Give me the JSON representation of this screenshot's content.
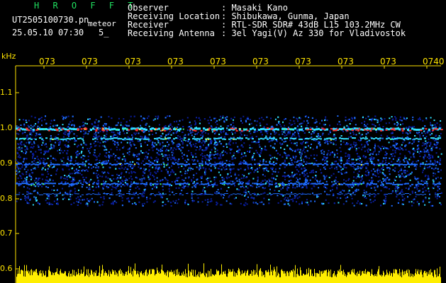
{
  "header": {
    "title": "H R O F F T",
    "filename": "UT2505100730.pn",
    "mode": "meteor",
    "date_time": "25.05.10 07:30",
    "interval": "5_",
    "fields": [
      {
        "label": "Observer",
        "value": ": Masaki Kano"
      },
      {
        "label": "Receiving Location",
        "value": ": Shibukawa, Gunma, Japan"
      },
      {
        "label": "Receiver",
        "value": ": RTL-SDR SDR# 43dB L15 103.2MHz CW"
      },
      {
        "label": "Receiving Antenna",
        "value": ": 3el Yagi(V) Az 330 for Vladivostok"
      }
    ]
  },
  "axes": {
    "y_unit": "kHz",
    "y_ticks": [
      "1.1",
      "1.0",
      "0.9",
      "0.8",
      "0.7",
      "0.6"
    ],
    "x_ticks": [
      "073",
      "073",
      "073",
      "073",
      "073",
      "073",
      "073",
      "073",
      "073",
      "0740"
    ]
  },
  "colors": {
    "axis": "#ffe400",
    "title": "#20e060",
    "text": "#ffffff",
    "noise_low": "#0a1ea0",
    "noise_mid": "#1e6cff",
    "noise_high": "#30e0ff",
    "signal": "#ff3030",
    "power_bar": "#ffee00"
  }
}
